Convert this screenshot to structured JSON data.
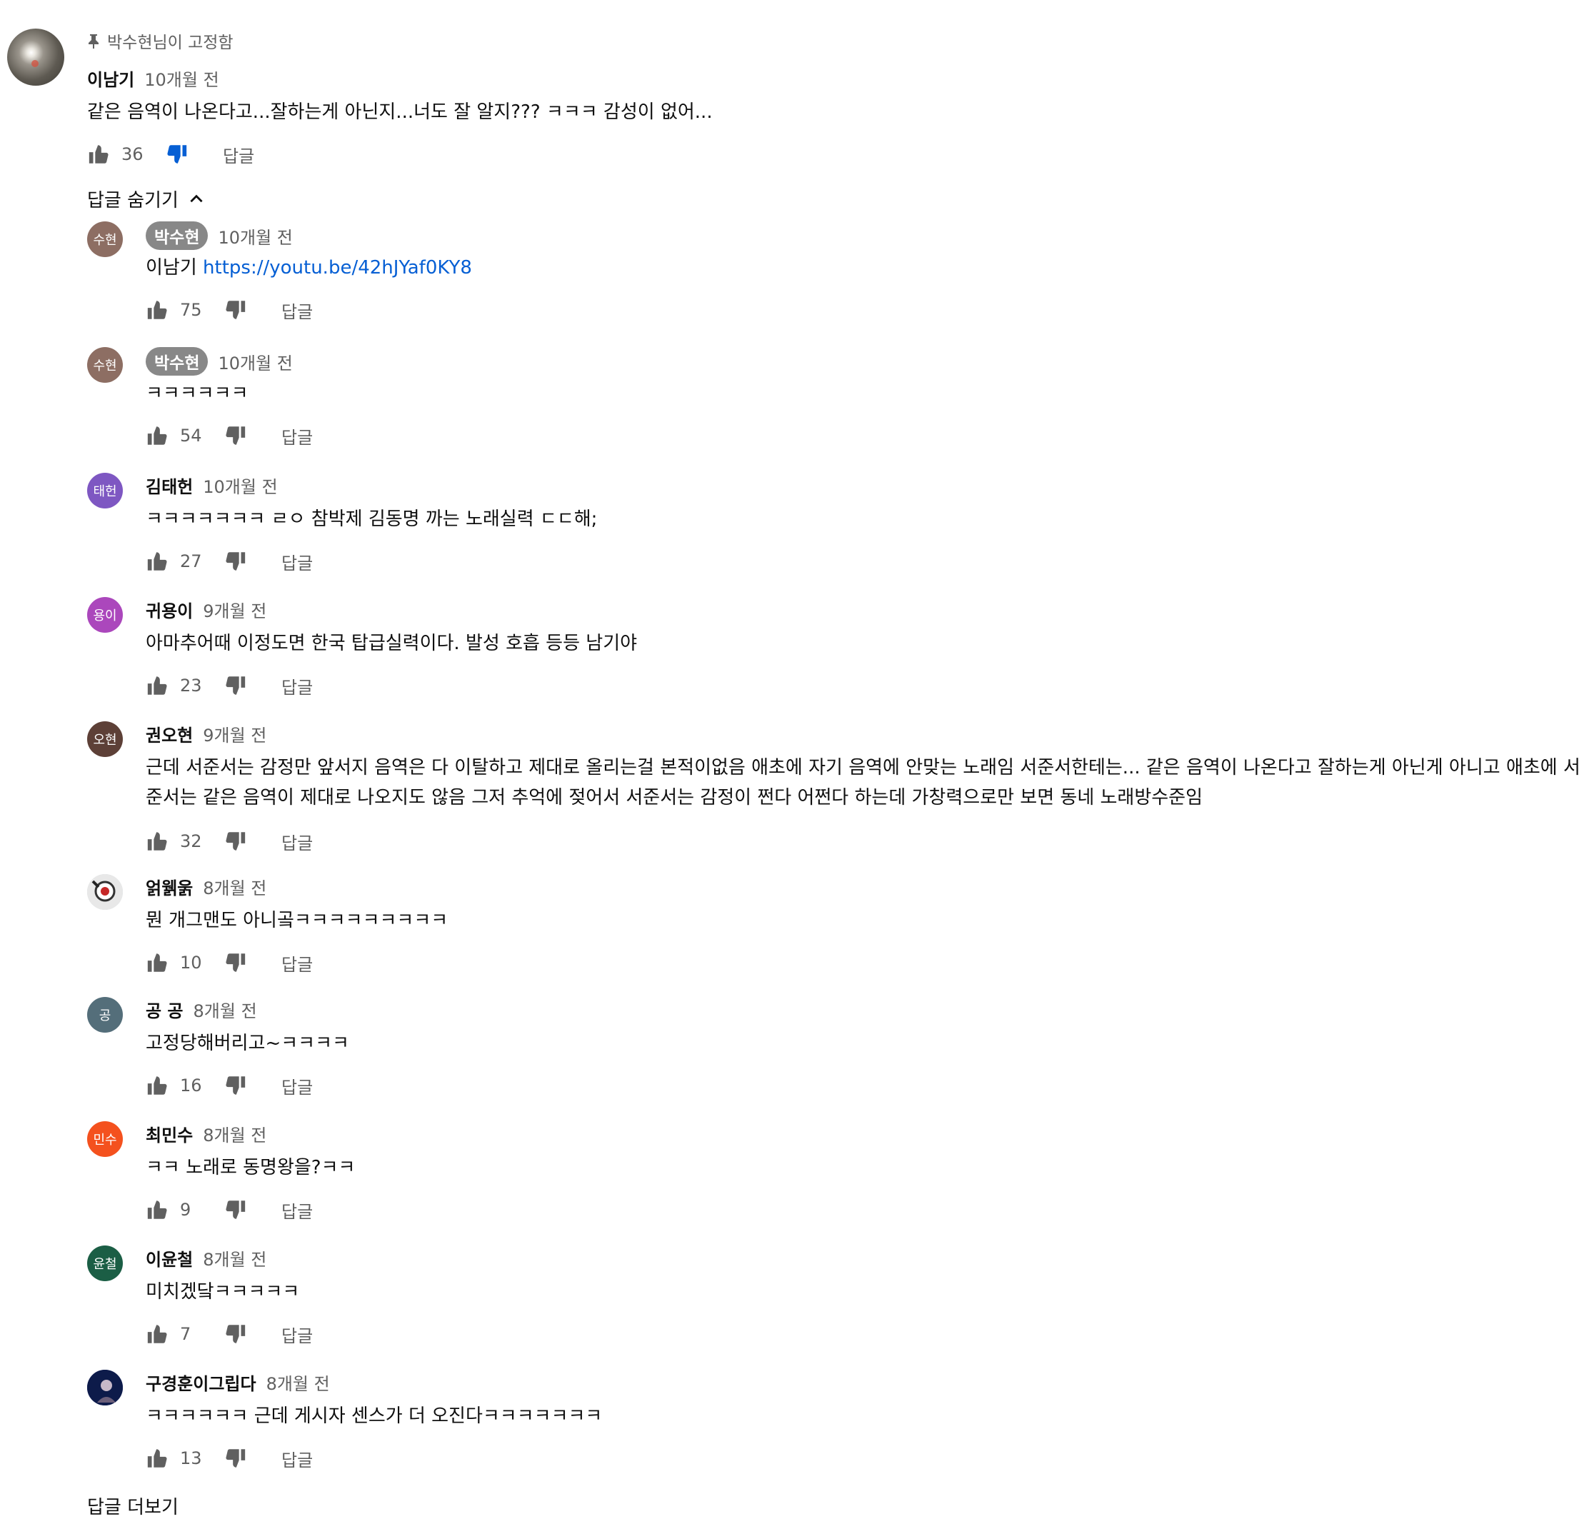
{
  "pinned_comment": {
    "pinned_by": "박수현님이 고정함",
    "author": "이남기",
    "time": "10개월 전",
    "text": "같은 음역이 나온다고...잘하는게 아닌지...너도 잘 알지??? ㅋㅋㅋ 감성이 없어...",
    "likes": "36",
    "reply_label": "답글",
    "dislike_active_color": "#065fd4"
  },
  "hide_replies_label": "답글 숨기기",
  "replies": [
    {
      "initials": "수현",
      "author": "박수현",
      "time": "10개월 전",
      "text_prefix": "이남기 ",
      "link": "https://youtu.be/42hJYaf0KY8",
      "likes": "75",
      "reply_label": "답글",
      "avatar_color": "#8d6e63",
      "owner": true
    },
    {
      "initials": "수현",
      "author": "박수현",
      "time": "10개월 전",
      "text": "ㅋㅋㅋㅋㅋㅋ",
      "likes": "54",
      "reply_label": "답글",
      "avatar_color": "#8d6e63",
      "owner": true
    },
    {
      "initials": "태헌",
      "author": "김태헌",
      "time": "10개월 전",
      "text": "ㅋㅋㅋㅋㅋㅋㅋ ㄹㅇ 참박제 김동명 까는 노래실력 ㄷㄷ해;",
      "likes": "27",
      "reply_label": "답글",
      "avatar_color": "#7e57c2"
    },
    {
      "initials": "용이",
      "author": "귀용이",
      "time": "9개월 전",
      "text": "아마추어때 이정도면 한국 탑급실력이다. 발성 호흡 등등 남기야",
      "likes": "23",
      "reply_label": "답글",
      "avatar_color": "#ab47bc"
    },
    {
      "initials": "오현",
      "author": "권오현",
      "time": "9개월 전",
      "text_line1": "근데 서준서는 감정만 앞서지 음역은 다 이탈하고 제대로 올리는걸 본적이없음 애초에 자기 음역에 안맞는 노래임 서준서한테는... 같은 음역이 나온다고 잘하는게 아닌게 아니고 애초에 서",
      "text_line2": "준서는 같은 음역이 제대로 나오지도 않음 그저 추억에 젖어서 서준서는 감정이 쩐다 어쩐다 하는데 가창력으로만 보면 동네 노래방수준임",
      "likes": "32",
      "reply_label": "답글",
      "avatar_color": "#5d4037"
    },
    {
      "initials": "",
      "author": "얽웱욹",
      "time": "8개월 전",
      "text": "뭔 개그맨도 아니곸ㅋㅋㅋㅋㅋㅋㅋㅋㅋ",
      "likes": "10",
      "reply_label": "답글",
      "avatar_color": "#cfd8dc"
    },
    {
      "initials": "공",
      "author": "공 공",
      "time": "8개월 전",
      "text": "고정당해버리고~ㅋㅋㅋㅋ",
      "likes": "16",
      "reply_label": "답글",
      "avatar_color": "#546e7a"
    },
    {
      "initials": "민수",
      "author": "최민수",
      "time": "8개월 전",
      "text": "ㅋㅋ 노래로 동명왕을?ㅋㅋ",
      "likes": "9",
      "reply_label": "답글",
      "avatar_color": "#f4511e"
    },
    {
      "initials": "윤철",
      "author": "이윤철",
      "time": "8개월 전",
      "text": "미치겠닼ㅋㅋㅋㅋㅋ",
      "likes": "7",
      "reply_label": "답글",
      "avatar_color": "#1b5e45"
    },
    {
      "initials": "",
      "author": "구경훈이그립다",
      "time": "8개월 전",
      "text": "ㅋㅋㅋㅋㅋㅋ 근데 게시자 센스가 더 오진다ㅋㅋㅋㅋㅋㅋㅋ",
      "likes": "13",
      "reply_label": "답글",
      "avatar_color": "#1a237e"
    }
  ],
  "more_replies_label": "답글 더보기"
}
